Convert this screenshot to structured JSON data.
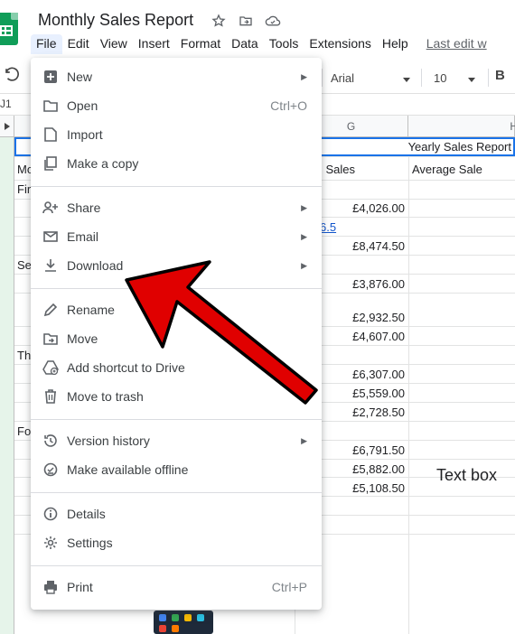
{
  "document": {
    "title": "Monthly Sales Report",
    "star_icon": "star-icon",
    "move_icon": "folder-move-icon",
    "cloud_icon": "cloud-status-icon"
  },
  "menu": {
    "file": "File",
    "edit": "Edit",
    "view": "View",
    "insert": "Insert",
    "format": "Format",
    "data": "Data",
    "tools": "Tools",
    "extensions": "Extensions",
    "help": "Help",
    "last_edit": "Last edit w"
  },
  "toolbar": {
    "font": "Arial",
    "font_size": "10",
    "bold": "B"
  },
  "formula_bar": {
    "name_box": "J1"
  },
  "grid": {
    "col_g": "G",
    "col_h": "H",
    "title_cell": "Yearly Sales Report",
    "header_total": "l Sales",
    "header_average": "Average Sale",
    "col_a_partial": [
      "Mo",
      "Fir",
      "Se",
      "Th",
      "Fo"
    ],
    "values": [
      "£4,026.00",
      "6.5",
      "£8,474.50",
      "£3,876.00",
      "£2,932.50",
      "£4,607.00",
      "£6,307.00",
      "£5,559.00",
      "£2,728.50",
      "£6,791.50",
      "£5,882.00",
      "£5,108.50"
    ],
    "text_box": "Text box"
  },
  "file_menu": {
    "items": [
      {
        "label": "New",
        "shortcut": "",
        "submenu": true,
        "icon": "new-icon"
      },
      {
        "label": "Open",
        "shortcut": "Ctrl+O",
        "submenu": false,
        "icon": "folder-icon"
      },
      {
        "label": "Import",
        "shortcut": "",
        "submenu": false,
        "icon": "file-icon"
      },
      {
        "label": "Make a copy",
        "shortcut": "",
        "submenu": false,
        "icon": "copy-icon"
      },
      {
        "label": "Share",
        "shortcut": "",
        "submenu": true,
        "icon": "person-add-icon"
      },
      {
        "label": "Email",
        "shortcut": "",
        "submenu": true,
        "icon": "email-icon"
      },
      {
        "label": "Download",
        "shortcut": "",
        "submenu": true,
        "icon": "download-icon"
      },
      {
        "label": "Rename",
        "shortcut": "",
        "submenu": false,
        "icon": "pencil-icon"
      },
      {
        "label": "Move",
        "shortcut": "",
        "submenu": false,
        "icon": "move-folder-icon"
      },
      {
        "label": "Add shortcut to Drive",
        "shortcut": "",
        "submenu": false,
        "icon": "drive-shortcut-icon"
      },
      {
        "label": "Move to trash",
        "shortcut": "",
        "submenu": false,
        "icon": "trash-icon"
      },
      {
        "label": "Version history",
        "shortcut": "",
        "submenu": true,
        "icon": "history-icon"
      },
      {
        "label": "Make available offline",
        "shortcut": "",
        "submenu": false,
        "icon": "offline-icon"
      },
      {
        "label": "Details",
        "shortcut": "",
        "submenu": false,
        "icon": "info-icon"
      },
      {
        "label": "Settings",
        "shortcut": "",
        "submenu": false,
        "icon": "gear-icon"
      },
      {
        "label": "Print",
        "shortcut": "Ctrl+P",
        "submenu": false,
        "icon": "printer-icon"
      }
    ]
  },
  "colors": {
    "accent": "#1a73e8",
    "sheets_green": "#0f9d58",
    "arrow_red": "#e00000"
  }
}
